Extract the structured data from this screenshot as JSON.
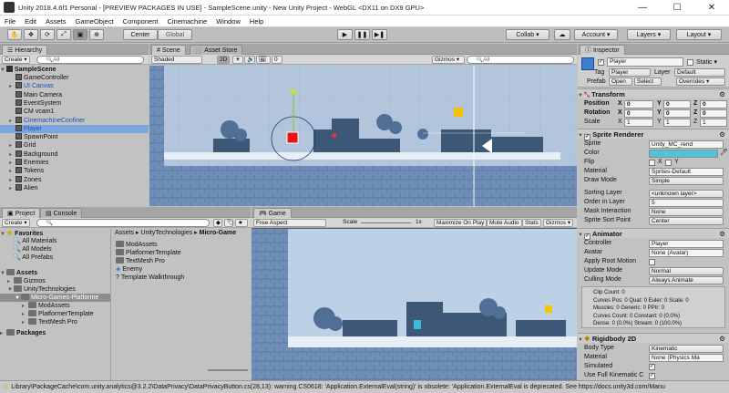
{
  "window": {
    "title": "Unity 2018.4.6f1 Personal - [PREVIEW PACKAGES IN USE] - SampleScene.unity - New Unity Project - WebGL <DX11 on DX9 GPU>",
    "minimize": "—",
    "maximize": "☐",
    "close": "✕"
  },
  "menu": [
    "File",
    "Edit",
    "Assets",
    "GameObject",
    "Component",
    "Cinemachine",
    "Window",
    "Help"
  ],
  "toolbar": {
    "pivot": "Center",
    "space": "Global",
    "collab": "Collab ▾",
    "account": "Account ▾",
    "layers": "Layers ▾",
    "layout": "Layout ▾"
  },
  "hierarchy": {
    "tab": "Hierarchy",
    "create": "Create ▾",
    "search": "All",
    "scene": "SampleScene",
    "items": [
      {
        "label": "GameController",
        "color": "#111111"
      },
      {
        "label": "UI Canvas",
        "color": "#1d4fb5"
      },
      {
        "label": "Main Camera",
        "color": "#111111"
      },
      {
        "label": "EventSystem",
        "color": "#111111"
      },
      {
        "label": "CM vcam1",
        "color": "#111111"
      },
      {
        "label": "CinemachineConfiner",
        "color": "#1d4fb5"
      },
      {
        "label": "Player",
        "color": "#1d4fb5"
      },
      {
        "label": "SpawnPoint",
        "color": "#111111"
      },
      {
        "label": "Grid",
        "color": "#111111"
      },
      {
        "label": "Background",
        "color": "#111111"
      },
      {
        "label": "Enemies",
        "color": "#111111"
      },
      {
        "label": "Tokens",
        "color": "#111111"
      },
      {
        "label": "Zones",
        "color": "#111111"
      },
      {
        "label": "Alien",
        "color": "#111111"
      }
    ]
  },
  "scene_view": {
    "tab_scene": "Scene",
    "tab_store": "Asset Store",
    "shading": "Shaded",
    "mode2d": "2D",
    "gizmos": "Gizmos ▾",
    "search": "All"
  },
  "game_view": {
    "tab": "Game",
    "aspect": "Free Aspect",
    "scale_label": "Scale",
    "scale_value": "1x",
    "maximize": "Maximize On Play",
    "mute": "Mute Audio",
    "stats": "Stats",
    "gizmos": "Gizmos ▾"
  },
  "project": {
    "tab_project": "Project",
    "tab_console": "Console",
    "create": "Create ▾",
    "favorites_label": "Favorites",
    "favorites": [
      "All Materials",
      "All Models",
      "All Prefabs"
    ],
    "assets_label": "Assets",
    "tree": [
      "Gizmos",
      "UnityTechnologies",
      "Micro-Games-Platforme",
      "ModAssets",
      "PlatformerTemplate",
      "TextMesh Pro"
    ],
    "packages_label": "Packages",
    "breadcrumb": [
      "Assets",
      "UnityTechnologies",
      "Micro-Game"
    ],
    "files": [
      "ModAssets",
      "PlatformerTemplate",
      "TextMesh Pro",
      "Enemy",
      "Template Walkthrough"
    ]
  },
  "inspector": {
    "tab": "Inspector",
    "object_name": "Player",
    "static_label": "Static ▾",
    "tag_label": "Tag",
    "tag_value": "Player",
    "layer_label": "Layer",
    "layer_value": "Default",
    "prefab_label": "Prefab",
    "prefab_open": "Open",
    "prefab_select": "Select",
    "prefab_overrides": "Overrides ▾",
    "transform": {
      "title": "Transform",
      "rows": [
        {
          "label": "Position",
          "x": "0",
          "y": "0",
          "z": "0"
        },
        {
          "label": "Rotation",
          "x": "0",
          "y": "0",
          "z": "0"
        },
        {
          "label": "Scale",
          "x": "1",
          "y": "1",
          "z": "1"
        }
      ]
    },
    "sprite_renderer": {
      "title": "Sprite Renderer",
      "sprite_label": "Sprite",
      "sprite_value": "Unity_MC_rend",
      "color_label": "Color",
      "flip_label": "Flip",
      "flip_x": "X",
      "flip_y": "Y",
      "material_label": "Material",
      "material_value": "Sprites-Default",
      "draw_mode_label": "Draw Mode",
      "draw_mode_value": "Simple",
      "sorting_layer_label": "Sorting Layer",
      "sorting_layer_value": "<unknown layer>",
      "order_label": "Order in Layer",
      "order_value": "5",
      "mask_label": "Mask Interaction",
      "mask_value": "None",
      "sort_point_label": "Sprite Sort Point",
      "sort_point_value": "Center"
    },
    "animator": {
      "title": "Animator",
      "controller_label": "Controller",
      "controller_value": "Player",
      "avatar_label": "Avatar",
      "avatar_value": "None (Avatar)",
      "root_motion_label": "Apply Root Motion",
      "update_label": "Update Mode",
      "update_value": "Normal",
      "culling_label": "Culling Mode",
      "culling_value": "Always Animate",
      "info": [
        "Clip Count: 0",
        "Curves Pos: 0 Quat: 0 Euler: 0 Scale: 0",
        "Muscles: 0 Generic: 0 PPtr: 0",
        "Curves Count: 0 Constant: 0 (0.0%)",
        "Dense: 0 (0.0%) Stream: 0 (100.0%)"
      ]
    },
    "rigidbody": {
      "title": "Rigidbody 2D",
      "body_type_label": "Body Type",
      "body_type_value": "Kinematic",
      "material_label": "Material",
      "material_value": "None (Physics Ma",
      "simulated_label": "Simulated",
      "kinematic_label": "Use Full Kinematic C"
    }
  },
  "status": {
    "message": "Library\\PackageCache\\com.unity.analytics@3.2.2\\DataPrivacy\\DataPrivacyButton.cs(28,13): warning CS0618: 'Application.ExternalEval(string)' is obsolete: 'Application.ExternalEval is deprecated. See https://docs.unity3d.com/Manu"
  },
  "colors": {
    "sprite_color": "#4fc3d9",
    "scene_sky": "#b2c5dd",
    "game_sky": "#bcd0e6",
    "building": "#3d5777",
    "warning": "#e0a800"
  }
}
